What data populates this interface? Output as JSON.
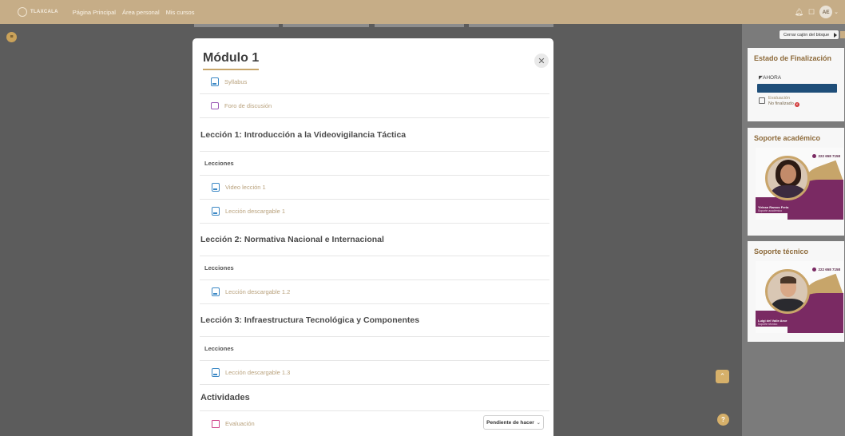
{
  "navbar": {
    "brand": "TLAXCALA",
    "links": [
      "Página Principal",
      "Área personal",
      "Mis cursos"
    ],
    "avatar_initials": "AE"
  },
  "sidebar": {
    "close_block_label": "Cerrar cajón del bloque",
    "completion": {
      "title": "Estado de Finalización",
      "now_label": "AHORA",
      "item_name": "Evaluación",
      "item_status": "No finalizado"
    },
    "academic_support": {
      "title": "Soporte académico",
      "phone": "222 658 7158",
      "person_name": "Yirlean Ramos Feria",
      "person_role": "Soporte académico"
    },
    "technical_support": {
      "title": "Soporte técnico",
      "phone": "222 658 7158",
      "person_name": "Luigi del Valle Arce",
      "person_role": "Soporte técnico"
    }
  },
  "modal": {
    "title": "Módulo 1",
    "items": {
      "syllabus": "Syllabus",
      "forum": "Foro de discusión",
      "lesson1_title": "Lección 1: Introducción a la Videovigilancia Táctica",
      "lesson1_sub": "Lecciones",
      "lesson1_video": "Video lección 1",
      "lesson1_download": "Lección descargable 1",
      "lesson2_title": "Lección 2: Normativa Nacional e Internacional",
      "lesson2_sub": "Lecciones",
      "lesson2_download": "Lección descargable 1.2",
      "lesson3_title": "Lección 3: Infraestructura Tecnológica y Componentes",
      "lesson3_sub": "Lecciones",
      "lesson3_download": "Lección descargable 1.3",
      "activities_title": "Actividades",
      "evaluation": "Evaluación",
      "pending_label": "Pendiente de hacer"
    }
  },
  "colors": {
    "navbar": "#c6ad87",
    "accent_gold": "#c7a56a",
    "progress": "#1f4e79",
    "support_purple": "#7a2a63"
  }
}
